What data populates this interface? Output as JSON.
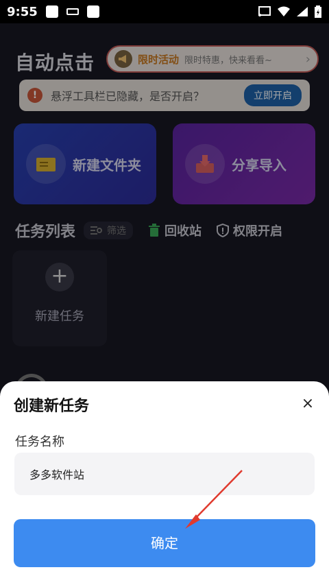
{
  "status_bar": {
    "time": "9:55"
  },
  "app": {
    "title": "自动点击",
    "promo": {
      "title": "限时活动",
      "text": "限时特惠，快来看看~",
      "arrow": "›"
    },
    "notice": {
      "icon": "!",
      "text": "悬浮工具栏已隐藏，是否开启？",
      "button": "立即开启"
    },
    "cards": {
      "new_folder": "新建文件夹",
      "share_import": "分享导入"
    },
    "task_list": {
      "title": "任务列表",
      "filter": "筛选",
      "recycle": "回收站",
      "permission": "权限开启",
      "new_task": "新建任务",
      "plus": "+"
    }
  },
  "dialog": {
    "title": "创建新任务",
    "close": "×",
    "field_label": "任务名称",
    "field_value": "多多软件站",
    "confirm": "确定"
  },
  "colors": {
    "accent": "#3d8bf0",
    "annotation_arrow": "#e03a2e"
  },
  "icons": [
    "megaphone-icon",
    "warning-icon",
    "folder-icon",
    "download-icon",
    "filter-icon",
    "trash-icon",
    "shield-icon",
    "plus-icon",
    "close-icon",
    "wifi-icon",
    "signal-icon",
    "battery-icon",
    "cast-icon"
  ]
}
